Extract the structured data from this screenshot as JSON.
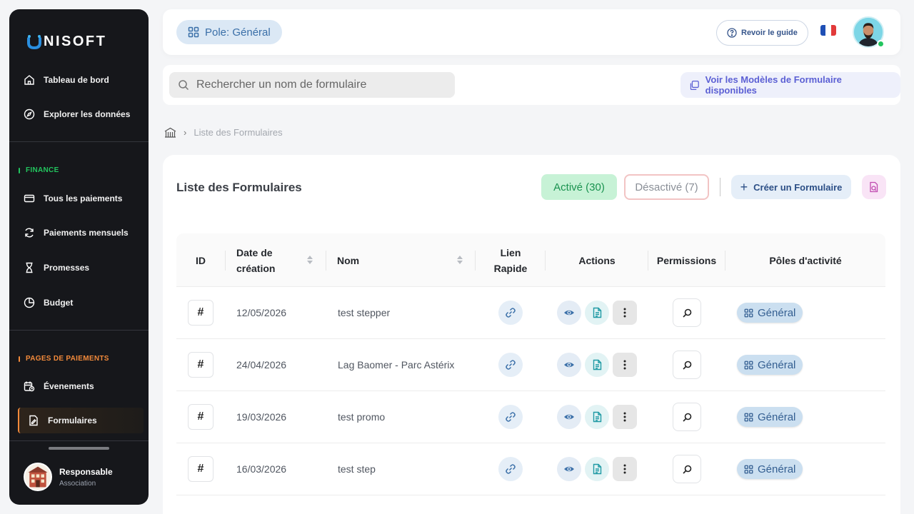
{
  "brand": {
    "logo_text": "NISOFT"
  },
  "sidebar": {
    "items": [
      {
        "label": "Tableau de bord",
        "icon": "home-icon"
      },
      {
        "label": "Explorer les données",
        "icon": "compass-icon"
      },
      {
        "label": "Tous les paiements",
        "icon": "card-icon"
      },
      {
        "label": "Paiements mensuels",
        "icon": "refresh-icon"
      },
      {
        "label": "Promesses",
        "icon": "hourglass-icon"
      },
      {
        "label": "Budget",
        "icon": "pie-icon"
      },
      {
        "label": "Évenements",
        "icon": "calendar-clock-icon"
      },
      {
        "label": "Formulaires",
        "icon": "form-icon",
        "active": true
      }
    ],
    "sections": {
      "finance": "FINANCE",
      "pages": "PAGES DE PAIEMENTS"
    },
    "section_colors": {
      "finance": "#22c55e",
      "pages": "#f28a3b"
    },
    "profile": {
      "name": "Responsable",
      "role": "Association"
    }
  },
  "topbar": {
    "pole_label": "Pole: Général",
    "guide_label": "Revoir le guide",
    "language": "fr"
  },
  "search": {
    "placeholder": "Rechercher un nom de formulaire",
    "models_label": "Voir les Modèles de Formulaire disponibles"
  },
  "breadcrumb": {
    "current": "Liste des Formulaires"
  },
  "card": {
    "title": "Liste des Formulaires",
    "active_label": "Activé (30)",
    "inactive_label": "Désactivé (7)",
    "create_label": "Créer un Formulaire"
  },
  "table": {
    "headers": {
      "id": "ID",
      "date_l1": "Date de",
      "date_l2": "création",
      "name": "Nom",
      "link_l1": "Lien",
      "link_l2": "Rapide",
      "actions": "Actions",
      "permissions": "Permissions",
      "poles": "Pôles d'activité"
    },
    "rows": [
      {
        "id": "#",
        "date": "12/05/2026",
        "name": "test stepper",
        "pole": "Général"
      },
      {
        "id": "#",
        "date": "24/04/2026",
        "name": "Lag Baomer - Parc Astérix",
        "pole": "Général"
      },
      {
        "id": "#",
        "date": "19/03/2026",
        "name": "test promo",
        "pole": "Général"
      },
      {
        "id": "#",
        "date": "16/03/2026",
        "name": "test step",
        "pole": "Général"
      }
    ]
  },
  "colors": {
    "accent": "#3a6fa8",
    "active_green": "#19924f",
    "orange": "#f28a3b",
    "purple": "#5b5fd4"
  }
}
